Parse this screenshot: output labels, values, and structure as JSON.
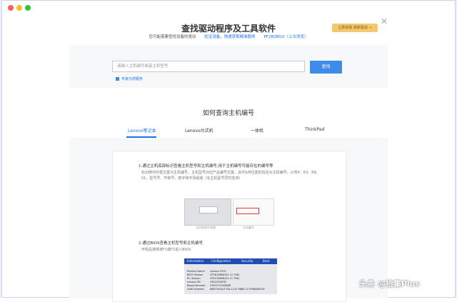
{
  "header": {
    "title": "查找驱动程序及工具软件",
    "prompt": "您可能需要查找设备的驱动",
    "detect_link": "检证设备，快速获取精准服务",
    "model_link": "PF2B2BGX（上次浏览）",
    "promo_label": "立即获取 最新驱动 →",
    "close_icon": "close-icon"
  },
  "search": {
    "placeholder": "请输入主机编号或者主机型号",
    "button_label": "查找",
    "expert_link": "专家为您服务"
  },
  "section": {
    "title": "如何查询主机编号"
  },
  "tabs": [
    {
      "label": "Lenovo笔记本",
      "active": true
    },
    {
      "label": "Lenovo台式机",
      "active": false
    },
    {
      "label": "一体机",
      "active": false
    },
    {
      "label": "ThinkPad",
      "active": false
    }
  ],
  "steps": [
    {
      "title": "1.通过主机底部标识查看主机型号和主机编号,用于主机编号可能存在的编号等",
      "desc": "标识牌中红框位置为主机编号，主机型号对应产品编号位置。具中S/N位置的信息为主机编号，公司P、R3、R8、S1、型号号、开辟号、数字和字母组成（全主机型号同时支持）"
    },
    {
      "title": "2.通过BIOS查看主机型号和主机编号",
      "desc": "开机后通常按F1或F2进入BIOS"
    }
  ],
  "images": {
    "laptop_caption": "主机底部外观图",
    "sticker_caption": "主机编号"
  },
  "bios": {
    "tabs": [
      "Information",
      "Configuration",
      "Security",
      "Boot"
    ],
    "rows": [
      {
        "key": "Product Name",
        "val": "Lenovo Y470"
      },
      {
        "key": "BIOS Version",
        "val": "4TCN16WW(V2.11 T08)"
      },
      {
        "key": "EC Version",
        "val": "4TEC16WW(V2.11 T08)"
      },
      {
        "key": "Lenovo SN",
        "val": "CB12345678"
      },
      {
        "key": "Board Number",
        "val": "2387272205886"
      },
      {
        "key": "UUID Number",
        "val": "8867340A-E70A-112F-9880-1C7598A8D20F"
      }
    ]
  },
  "watermark": {
    "text": "头条 @拾集Plus"
  },
  "colors": {
    "accent": "#1a73e8",
    "button": "#3f8ce8",
    "promo": "#f2c96b",
    "bios_header": "#1f4db3"
  }
}
